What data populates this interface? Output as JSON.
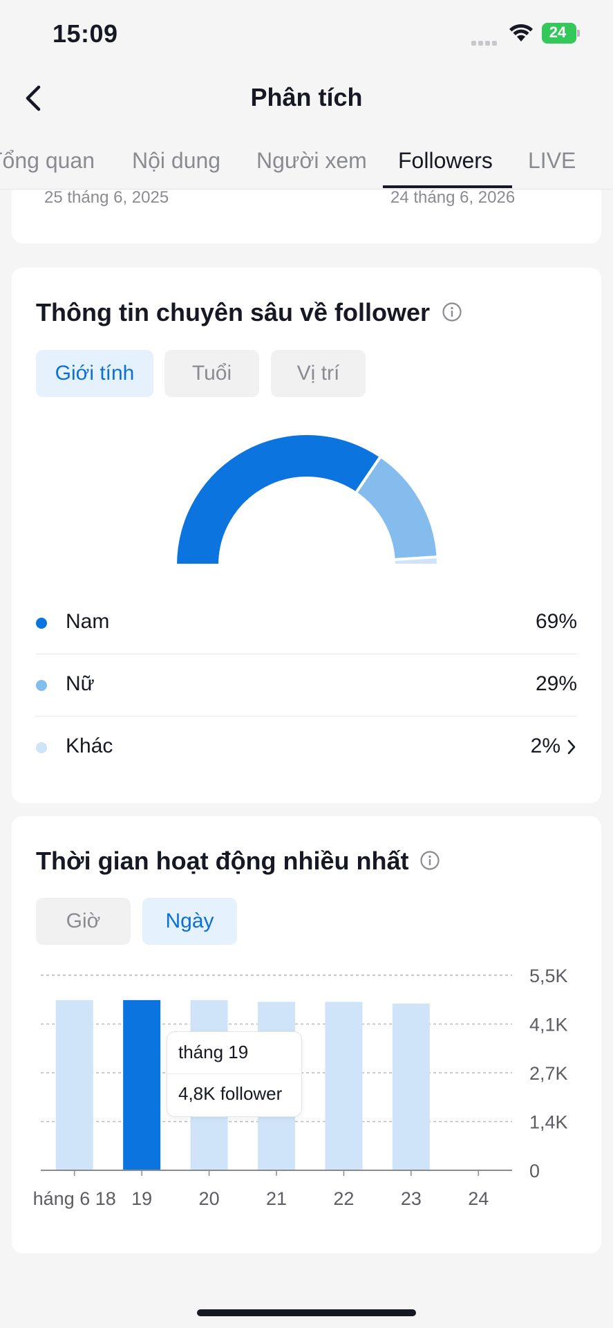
{
  "status_bar": {
    "time": "15:09",
    "battery": "24"
  },
  "header": {
    "title": "Phân tích"
  },
  "tabs": [
    {
      "label": "Tổng quan"
    },
    {
      "label": "Nội dung"
    },
    {
      "label": "Người xem"
    },
    {
      "label": "Followers",
      "active": true
    },
    {
      "label": "LIVE"
    }
  ],
  "date_range": {
    "start": "25 tháng 6, 2025",
    "end": "24 tháng 6, 2026"
  },
  "follower_insights": {
    "title": "Thông tin chuyên sâu về follower",
    "filters": [
      {
        "label": "Giới tính",
        "active": true
      },
      {
        "label": "Tuổi",
        "active": false
      },
      {
        "label": "Vị trí",
        "active": false
      }
    ],
    "gender": [
      {
        "label": "Nam",
        "value": "69%",
        "percent": 69,
        "color": "#0b74de"
      },
      {
        "label": "Nữ",
        "value": "29%",
        "percent": 29,
        "color": "#85bcee"
      },
      {
        "label": "Khác",
        "value": "2%",
        "percent": 2,
        "color": "#cfe4f8"
      }
    ]
  },
  "active_times": {
    "title": "Thời gian hoạt động nhiều nhất",
    "filters": [
      {
        "label": "Giờ",
        "active": false
      },
      {
        "label": "Ngày",
        "active": true
      }
    ],
    "tooltip": {
      "date": "tháng 19",
      "value": "4,8K follower"
    }
  },
  "chart_data": {
    "type": "bar",
    "categories": [
      "háng 6 18",
      "19",
      "20",
      "21",
      "22",
      "23",
      "24"
    ],
    "values": [
      4.8,
      4.8,
      4.8,
      4.75,
      4.75,
      4.7,
      0
    ],
    "highlighted_index": 1,
    "y_ticks": [
      "0",
      "1,4K",
      "2,7K",
      "4,1K",
      "5,5K"
    ],
    "ylim": [
      0,
      5.5
    ],
    "grid": true,
    "colors": {
      "bar": "#cfe4f8",
      "highlight": "#0b74de"
    }
  }
}
